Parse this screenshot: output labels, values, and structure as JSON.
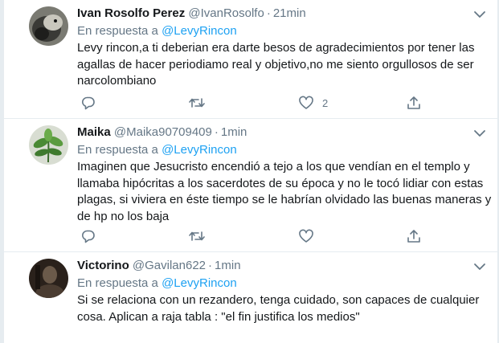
{
  "tweets": [
    {
      "name": "Ivan Rosolfo Perez",
      "handle": "@IvanRosolfo",
      "dot": "·",
      "time": "21min",
      "reply_prefix": "En respuesta a",
      "reply_to": "@LevyRincon",
      "lines": [
        "Levy rincon,a ti deberian era darte besos de agradecimientos por tener las",
        "agallas de hacer periodiamo real y objetivo,no me siento orgullosos de ser",
        "narcolombiano"
      ],
      "like_count": "2",
      "avatar_icon": "dog-photo-avatar"
    },
    {
      "name": "Maika",
      "handle": "@Maika90709409",
      "dot": "·",
      "time": "1min",
      "reply_prefix": "En respuesta a",
      "reply_to": "@LevyRincon",
      "lines": [
        "Imaginen que Jesucristo encendió a tejo a los que vendían en el templo y",
        "llamaba hipócritas a los sacerdotes de su época y no le tocó lidiar con estas",
        "plagas, si viviera en éste tiempo se le habrían olvidado las buenas maneras y",
        "de hp no los baja"
      ],
      "like_count": "",
      "avatar_icon": "plant-photo-avatar"
    },
    {
      "name": "Victorino",
      "handle": "@Gavilan622",
      "dot": "·",
      "time": "1min",
      "reply_prefix": "En respuesta a",
      "reply_to": "@LevyRincon",
      "lines": [
        "Si se relaciona con un rezandero, tenga cuidado, son capaces de cualquier",
        "cosa. Aplican a raja tabla : \"el fin justifica los medios\""
      ],
      "like_count": "",
      "avatar_icon": "dark-photo-avatar"
    }
  ],
  "colors": {
    "link": "#1da1f2",
    "muted": "#657786",
    "text": "#14171a",
    "divider": "#e6ecf0"
  },
  "icons": [
    "reply-icon",
    "retweet-icon",
    "like-icon",
    "share-icon",
    "chevron-down-icon"
  ]
}
